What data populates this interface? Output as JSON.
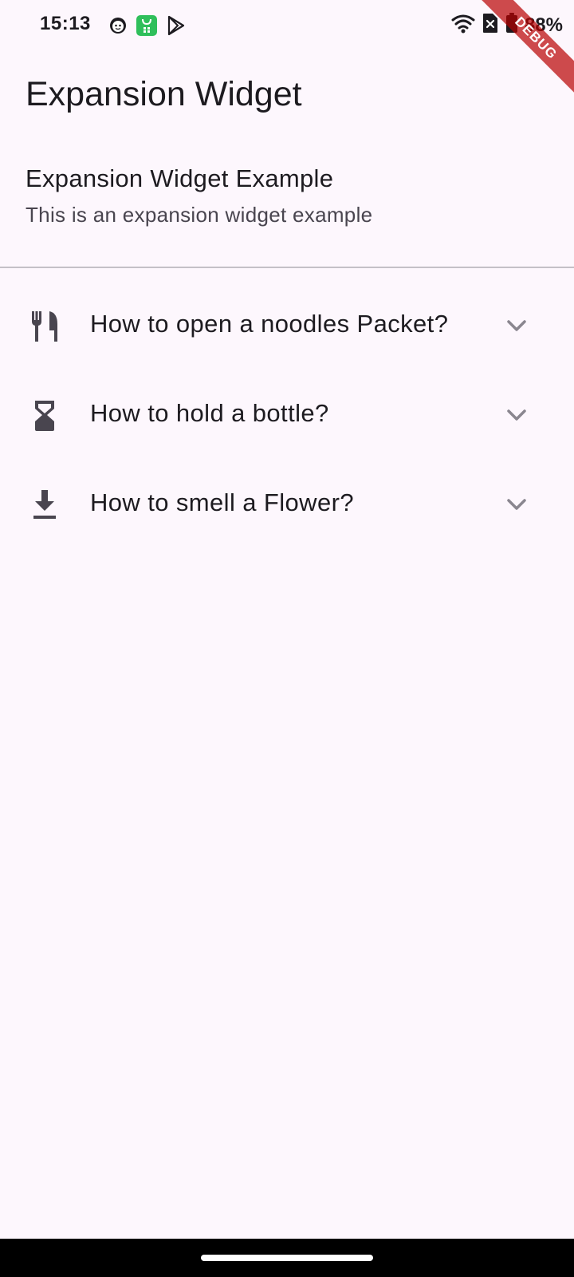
{
  "status_bar": {
    "time": "15:13",
    "left_icons": [
      "face-icon",
      "shopping-bag-icon",
      "play-store-icon"
    ],
    "right_icons": [
      "wifi-icon",
      "no-sim-icon",
      "battery-icon"
    ],
    "battery": "88%"
  },
  "debug_banner": "DEBUG",
  "app_bar": {
    "title": "Expansion Widget"
  },
  "header": {
    "title": "Expansion Widget Example",
    "subtitle": "This is an expansion widget example"
  },
  "expansion_tiles": [
    {
      "icon": "restaurant-icon",
      "title": "How to open a noodles Packet?",
      "expanded": false
    },
    {
      "icon": "hourglass-icon",
      "title": "How to hold a bottle?",
      "expanded": false
    },
    {
      "icon": "download-icon",
      "title": "How to smell a Flower?",
      "expanded": false
    }
  ],
  "colors": {
    "background": "#fdf7fd",
    "text_primary": "#1d1b20",
    "text_secondary": "#49454f",
    "icon": "#49454f",
    "chevron": "#8a868f",
    "divider": "#c4c0c7",
    "debug_banner": "#b80000"
  }
}
